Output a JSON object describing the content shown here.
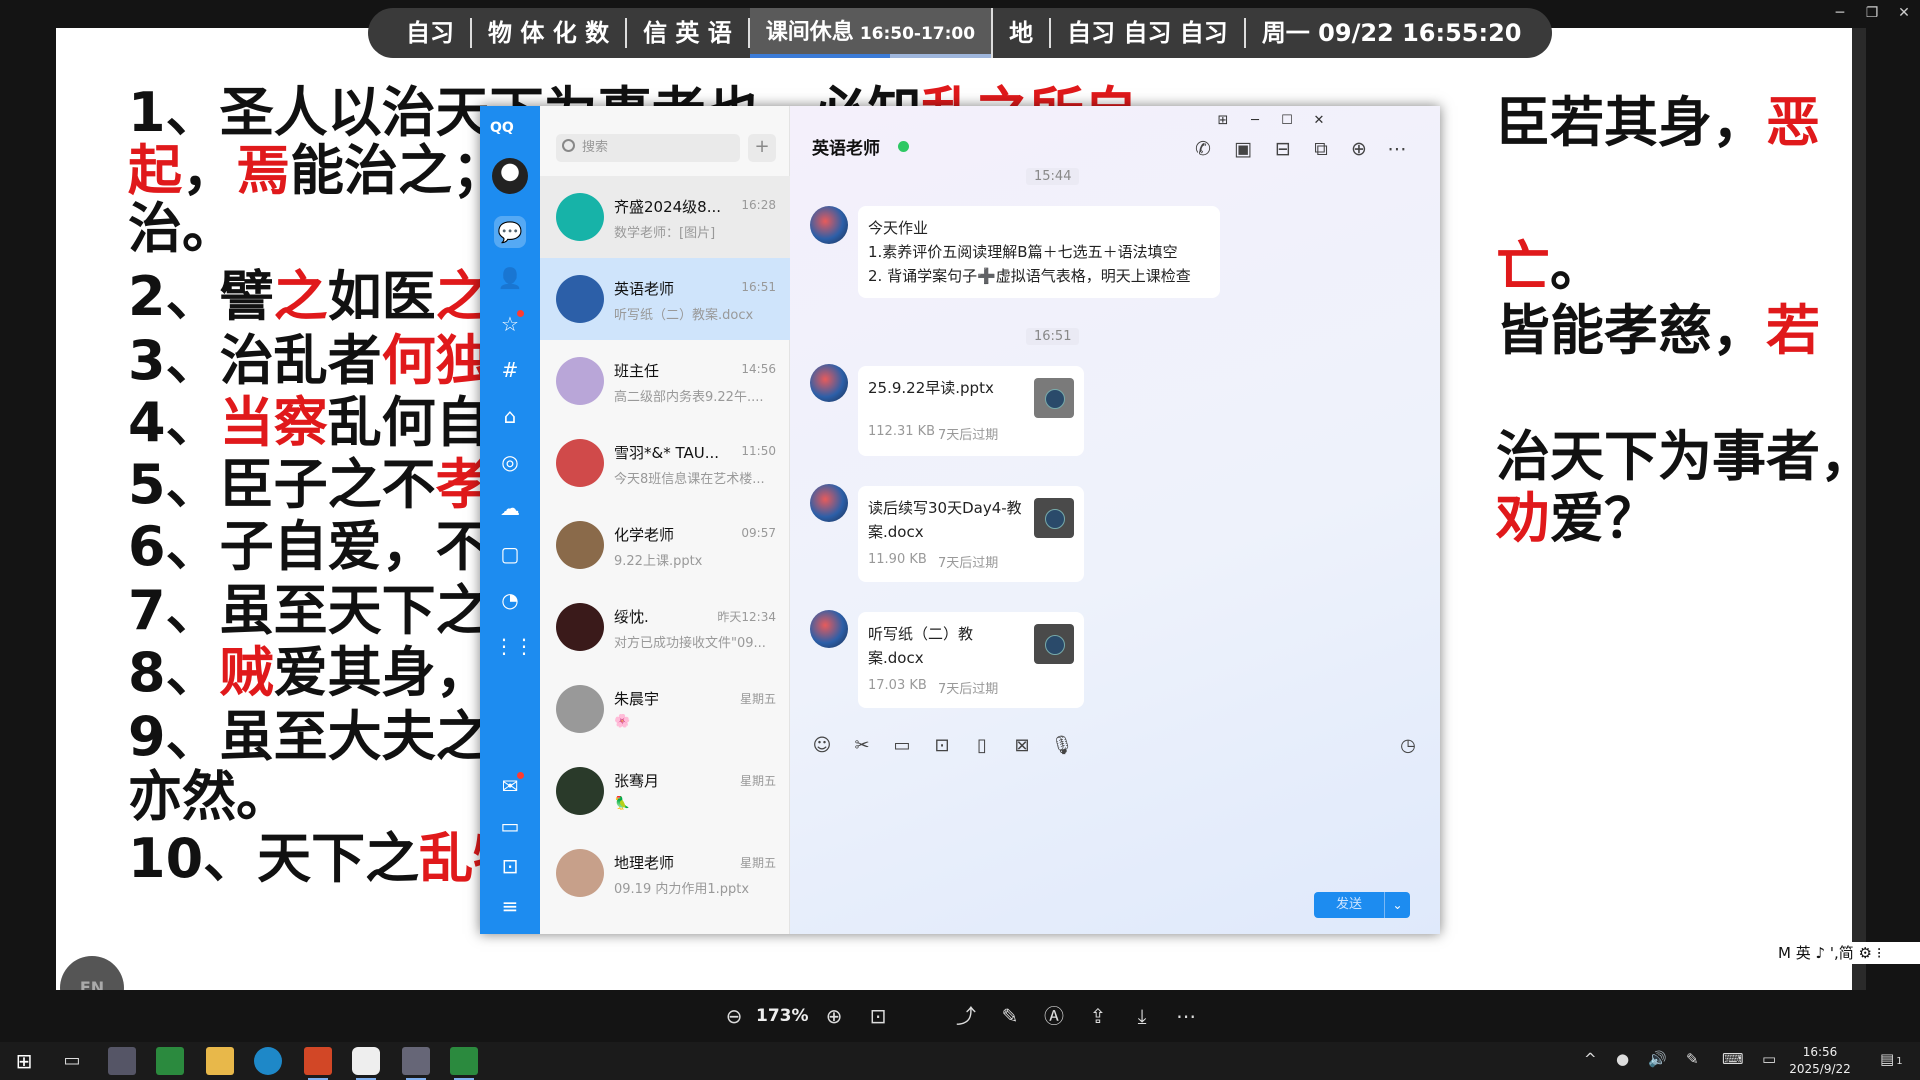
{
  "topbar": {
    "segments": [
      "自习",
      "物 体 化 数",
      "信 英 语"
    ],
    "active_label": "课间休息",
    "active_time": "16:50-17:00",
    "after": [
      "地",
      "自习 自习 自习"
    ],
    "datetime": "周一 09/22  16:55:20"
  },
  "slide": {
    "lines": [
      {
        "n": "1、",
        "parts": [
          "圣人以治天下为事者也，必知",
          {
            "red": "乱之所自"
          }
        ]
      },
      {
        "n": "",
        "parts": [
          {
            "red": "起"
          },
          "，",
          {
            "red": "焉"
          },
          "能治之；"
        ]
      },
      {
        "n": "",
        "parts": [
          "治。"
        ]
      },
      {
        "n": "2、",
        "parts": [
          "譬",
          {
            "red": "之"
          },
          "如医",
          {
            "red": "之"
          }
        ]
      },
      {
        "n": "3、",
        "parts": [
          "治乱者",
          {
            "red": "何独"
          }
        ]
      },
      {
        "n": "4、",
        "parts": [
          {
            "red": "当察"
          },
          "乱何自起"
        ]
      },
      {
        "n": "5、",
        "parts": [
          "臣子之不",
          {
            "red": "孝"
          }
        ]
      },
      {
        "n": "6、",
        "parts": [
          "子自爱，不爱"
        ]
      },
      {
        "n": "7、",
        "parts": [
          "虽至天下之为"
        ]
      },
      {
        "n": "8、",
        "parts": [
          {
            "red": "贼"
          },
          "爱其身，不"
        ]
      },
      {
        "n": "9、",
        "parts": [
          "虽至大夫之相"
        ]
      },
      {
        "n": "",
        "parts": [
          "亦然。"
        ]
      },
      {
        "n": "10、",
        "parts": [
          "天下之",
          {
            "red": "乱物"
          }
        ]
      }
    ],
    "right_lines": [
      {
        "parts": [
          "臣若其身，",
          {
            "red": "恶"
          }
        ]
      },
      {
        "parts": [
          {
            "red": "亡"
          },
          "。"
        ]
      },
      {
        "parts": [
          "皆能孝慈，",
          {
            "red": "若"
          }
        ]
      },
      {
        "parts": [
          "治天下为事者，"
        ]
      },
      {
        "parts": [
          {
            "red": "劝"
          },
          "爱？"
        ]
      }
    ]
  },
  "qq": {
    "logo": "QQ",
    "search_placeholder": "搜索",
    "conversations": [
      {
        "name": "齐盛2024级8...",
        "time": "16:28",
        "preview": "数学老师：[图片]",
        "avatar_color": "#17b3a8"
      },
      {
        "name": "英语老师",
        "time": "16:51",
        "preview": "听写纸（二）教案.docx",
        "avatar_color": "#2c5fa8"
      },
      {
        "name": "班主任",
        "time": "14:56",
        "preview": "高二级部内务表9.22午....",
        "avatar_color": "#b9a6d8"
      },
      {
        "name": "雪羽*&* TAU...",
        "time": "11:50",
        "preview": "今天8班信息课在艺术楼...",
        "avatar_color": "#d04a4a"
      },
      {
        "name": "化学老师",
        "time": "09:57",
        "preview": "9.22上课.pptx",
        "avatar_color": "#8a6a4a"
      },
      {
        "name": "绥忱.",
        "time": "昨天12:34",
        "preview": "对方已成功接收文件\"09...",
        "avatar_color": "#3a1a1a"
      },
      {
        "name": "朱晨宇",
        "time": "星期五",
        "preview": "🌸",
        "avatar_color": "#999999"
      },
      {
        "name": "张骞月",
        "time": "星期五",
        "preview": "🦜",
        "avatar_color": "#2a3a2a"
      },
      {
        "name": "地理老师",
        "time": "星期五",
        "preview": "09.19 内力作用1.pptx",
        "avatar_color": "#c7a08a"
      }
    ],
    "chat": {
      "title": "英语老师",
      "time1": "15:44",
      "homework": [
        "今天作业",
        "1.素养评价五阅读理解B篇＋七选五＋语法填空",
        "2. 背诵学案句子➕虚拟语气表格，明天上课检查"
      ],
      "time2": "16:51",
      "files": [
        {
          "name": "25.9.22早读.pptx",
          "size": "112.31 KB",
          "expire": "7天后过期"
        },
        {
          "name": "读后续写30天Day4-教案.docx",
          "size": "11.90 KB",
          "expire": "7天后过期"
        },
        {
          "name": "听写纸（二）教案.docx",
          "size": "17.03 KB",
          "expire": "7天后过期"
        }
      ],
      "send": "发送"
    }
  },
  "viewer": {
    "zoom": "173%"
  },
  "ime": "M 英 ♪ ',简 ⚙ ⁝",
  "en_badge": "EN",
  "tray": {
    "time": "16:56",
    "date": "2025/9/22",
    "notif": "1"
  },
  "colors": {
    "qq_blue": "#1d8cf0",
    "slide_red": "#e0191b"
  }
}
